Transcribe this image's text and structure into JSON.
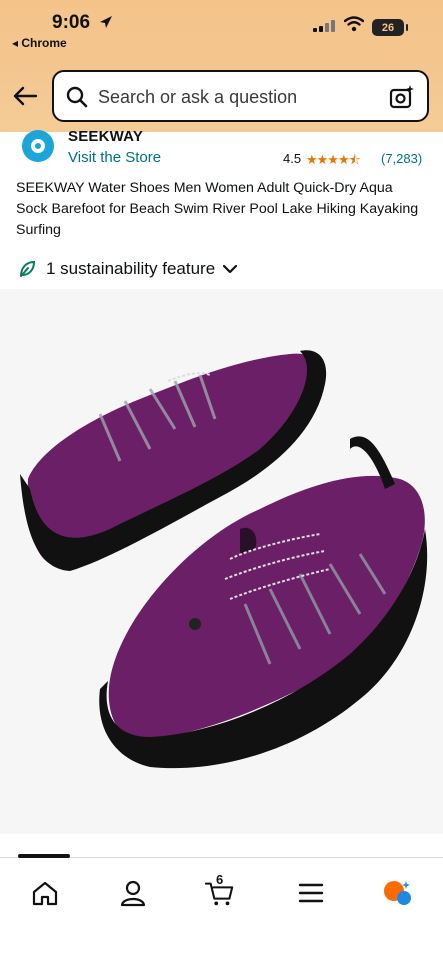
{
  "status_bar": {
    "time": "9:06",
    "back_app": "◂ Chrome",
    "battery": "26"
  },
  "search": {
    "placeholder": "Search or ask a question"
  },
  "product": {
    "brand": "SEEKWAY",
    "visit_store": "Visit the Store",
    "rating": "4.5",
    "stars": "★★★★⯪",
    "rating_count": "(7,283)",
    "title": "SEEKWAY Water Shoes Men Women Adult Quick-Dry Aqua Sock Barefoot for Beach Swim River Pool Lake Hiking Kayaking Surfing",
    "sustainability": "1 sustainability feature"
  },
  "bottom_nav": {
    "cart_count": "6",
    "items": [
      "home-icon",
      "account-icon",
      "cart-icon",
      "menu-icon",
      "rufus-icon"
    ]
  },
  "colors": {
    "header_bg": "#f3c38a",
    "link": "#007185",
    "star": "#e77600",
    "shoe": "#6b1f66"
  }
}
